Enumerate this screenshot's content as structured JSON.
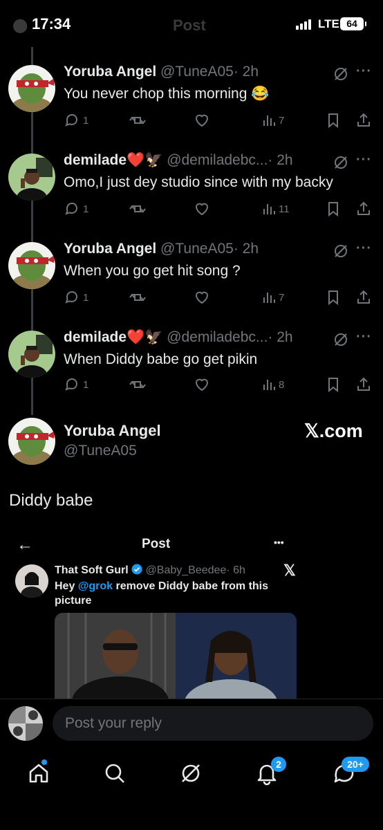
{
  "status_bar": {
    "time": "17:34",
    "network": "LTE",
    "battery": "64"
  },
  "background_header": {
    "title": "Post"
  },
  "tweets": [
    {
      "name": "Yoruba Angel",
      "handle": "@TuneA05",
      "time": "· 2h",
      "text": "You never chop this morning 😂",
      "replies": "1",
      "views": "7",
      "avatar": "tmnt-raphael-avatar"
    },
    {
      "name": "demilade❤️🦅",
      "handle": "@demiladebc...",
      "time": "· 2h",
      "text": "Omo,I just dey studio since with my backy",
      "replies": "1",
      "views": "11",
      "avatar": "demilade-avatar"
    },
    {
      "name": "Yoruba Angel",
      "handle": "@TuneA05",
      "time": "· 2h",
      "text": "When you go get hit song ?",
      "replies": "1",
      "views": "7",
      "avatar": "tmnt-raphael-avatar"
    },
    {
      "name": "demilade❤️🦅",
      "handle": "@demiladebc...",
      "time": "· 2h",
      "text": "When Diddy babe go get pikin",
      "replies": "1",
      "views": "8",
      "avatar": "demilade-avatar"
    }
  ],
  "focused_post": {
    "name": "Yoruba Angel",
    "handle": "@TuneA05",
    "watermark": "𝕏.com",
    "text": "Diddy babe"
  },
  "embedded_screenshot": {
    "header_title": "Post",
    "more": "•••",
    "tweet": {
      "name": "That Soft Gurl",
      "handle": "@Baby_Beedee",
      "time": "· 6h",
      "text_mention": "Hey ",
      "mention": "@grok",
      "text_rest": " remove Diddy babe from this picture"
    }
  },
  "reply": {
    "placeholder": "Post your reply"
  },
  "bottom_nav": {
    "notifications_badge": "2",
    "messages_badge": "20+"
  },
  "colors": {
    "background": "#000000",
    "text": "#e7e9ea",
    "muted": "#71767b",
    "accent": "#1d9bf0",
    "heart": "#f91880"
  }
}
